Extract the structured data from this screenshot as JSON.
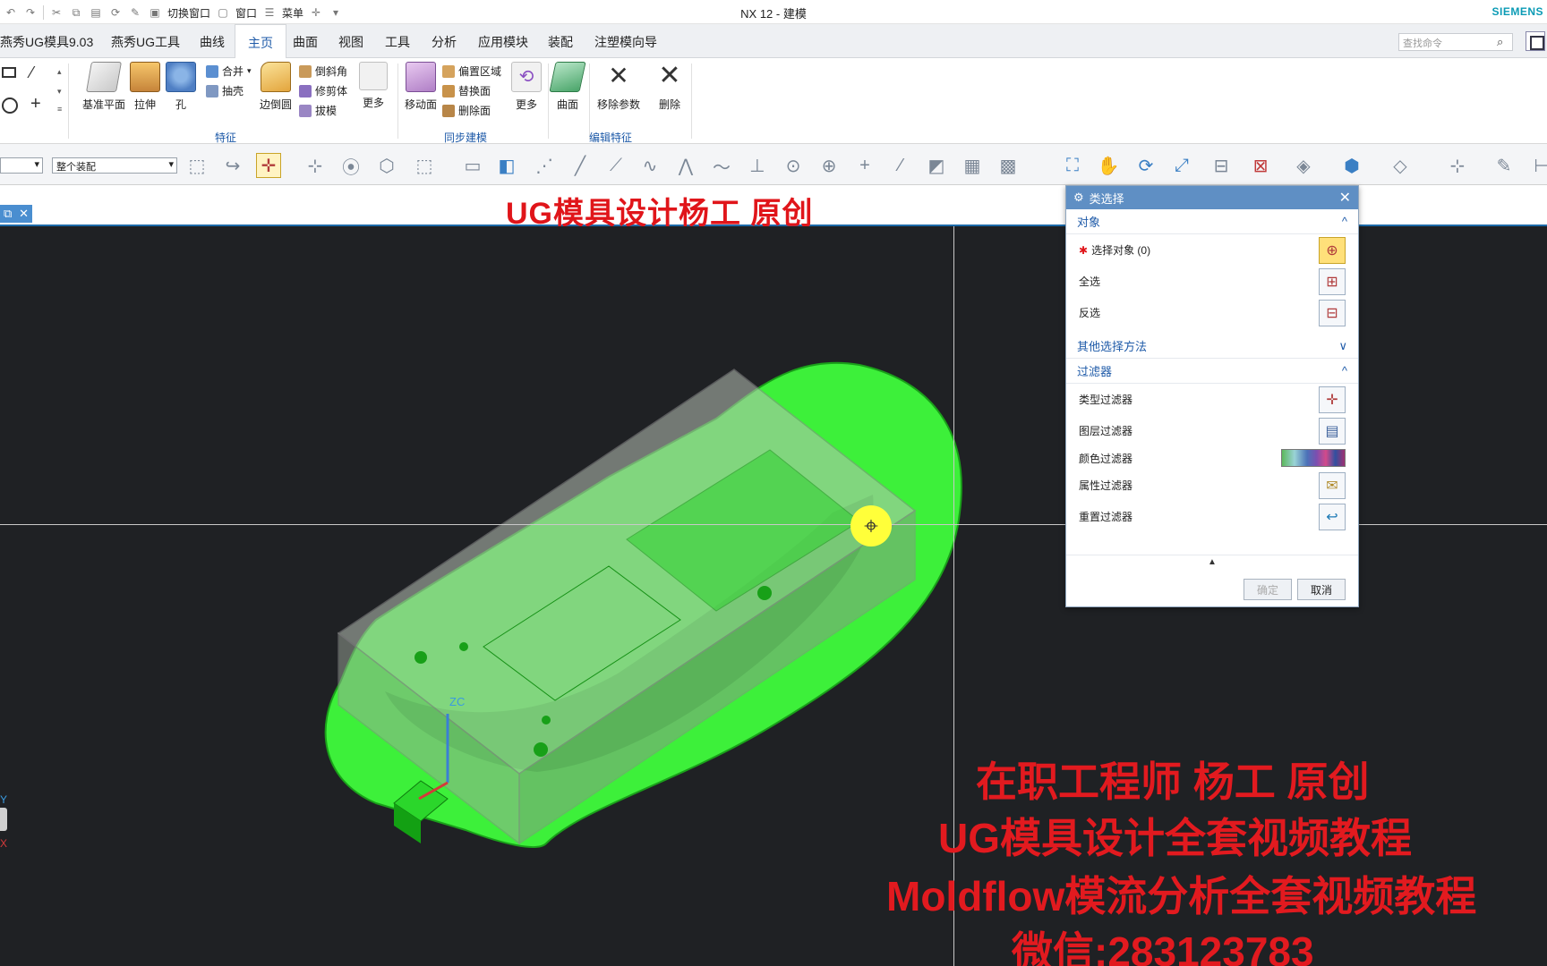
{
  "window": {
    "title": "NX 12 - 建模",
    "brand": "SIEMENS"
  },
  "quick_access": {
    "switch_window": "切换窗口",
    "window": "窗口",
    "menu": "菜单"
  },
  "tabs": [
    {
      "label": "燕秀UG模具9.03"
    },
    {
      "label": "燕秀UG工具"
    },
    {
      "label": "曲线"
    },
    {
      "label": "主页"
    },
    {
      "label": "曲面"
    },
    {
      "label": "视图"
    },
    {
      "label": "工具"
    },
    {
      "label": "分析"
    },
    {
      "label": "应用模块"
    },
    {
      "label": "装配"
    },
    {
      "label": "注塑模向导"
    }
  ],
  "search": {
    "placeholder": "查找命令"
  },
  "ribbon": {
    "datum_plane": "基准平面",
    "extrude": "拉伸",
    "hole": "孔",
    "unite": "合并",
    "shell": "抽壳",
    "edge_blend": "边倒圆",
    "chamfer": "倒斜角",
    "trim_body": "修剪体",
    "draft": "拔模",
    "more1": "更多",
    "feature_group": "特征",
    "move_face": "移动面",
    "offset_region": "偏置区域",
    "replace_face": "替换面",
    "delete_face": "删除面",
    "more2": "更多",
    "sync_group": "同步建模",
    "surface": "曲面",
    "remove_params": "移除参数",
    "delete": "删除",
    "edit_feature_group": "编辑特征"
  },
  "selection_bar": {
    "scope": "整个装配"
  },
  "watermark_top": "UG模具设计杨工 原创",
  "overlay": {
    "line1": "在职工程师 杨工 原创",
    "line2": "UG模具设计全套视频教程",
    "line3": "Moldflow模流分析全套视频教程",
    "line4": "微信:283123783"
  },
  "triad": {
    "zc": "ZC",
    "y": "Y",
    "x": "X"
  },
  "dialog": {
    "title": "类选择",
    "object_section": "对象",
    "select_object": "选择对象 (0)",
    "select_all": "全选",
    "invert": "反选",
    "other_methods": "其他选择方法",
    "filter_section": "过滤器",
    "type_filter": "类型过滤器",
    "layer_filter": "图层过滤器",
    "color_filter": "颜色过滤器",
    "attribute_filter": "属性过滤器",
    "reset_filter": "重置过滤器",
    "ok": "确定",
    "cancel": "取消"
  },
  "colors": {
    "accent": "#1e5aa8",
    "dialog_header": "#5f8fc4",
    "part_green": "#3df03a",
    "watermark_red": "#e0151a"
  }
}
